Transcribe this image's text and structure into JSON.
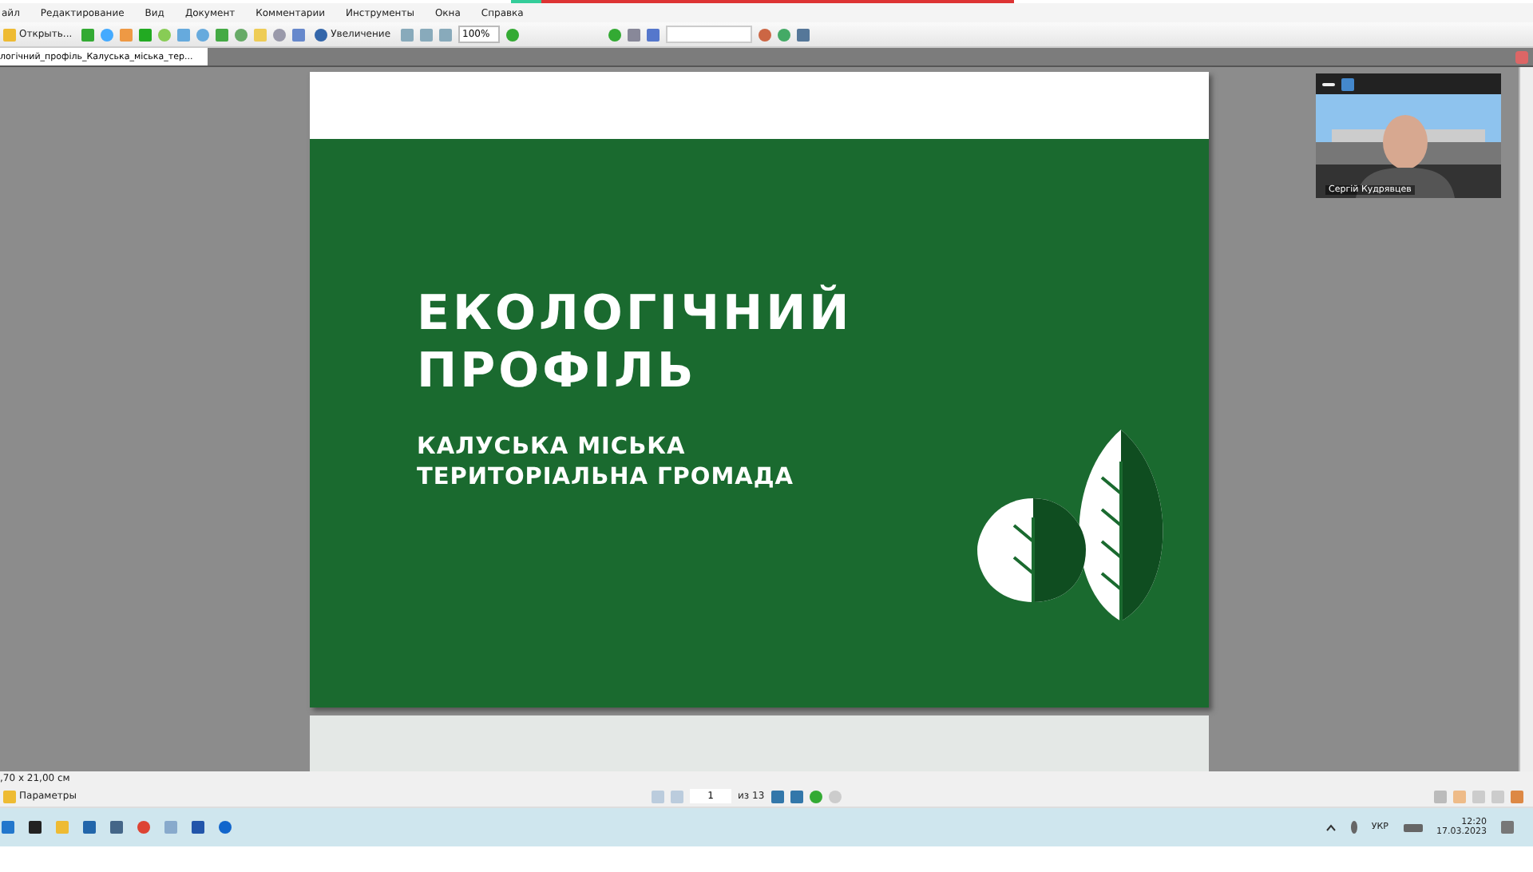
{
  "menu": [
    "айл",
    "Редактирование",
    "Вид",
    "Документ",
    "Комментарии",
    "Инструменты",
    "Окна",
    "Справка"
  ],
  "toolbar": {
    "open": "Открыть...",
    "zoom": "Увеличение",
    "zoom_value": "100%"
  },
  "tab": {
    "label": "логічний_профіль_Калуська_міська_тер...",
    "selected": true
  },
  "slide": {
    "title": [
      "ЕКОЛОГІЧНИЙ",
      "ПРОФІЛЬ"
    ],
    "subtitle": [
      "КАЛУСЬКА МІСЬКА",
      "ТЕРИТОРІАЛЬНА ГРОМАДА"
    ]
  },
  "video": {
    "name": "Сергій Кудрявцев"
  },
  "status": {
    "size": ",70 x 21,00 см",
    "options": "Параметры",
    "page": "1",
    "of": "из 13"
  },
  "tray": {
    "language": "УКР",
    "time": "12:20",
    "date": "17.03.2023"
  }
}
